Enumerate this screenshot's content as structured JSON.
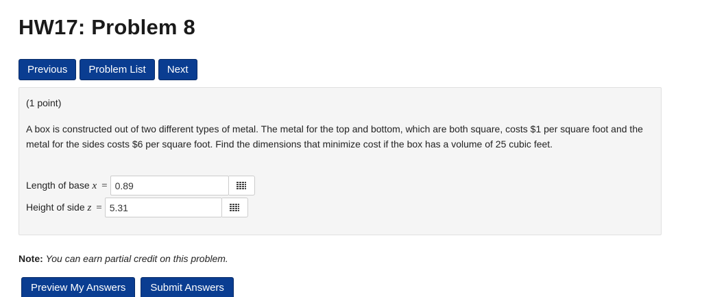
{
  "page": {
    "title": "HW17: Problem 8"
  },
  "nav": {
    "previous_label": "Previous",
    "problem_list_label": "Problem List",
    "next_label": "Next"
  },
  "problem": {
    "points": "(1 point)",
    "text": "A box is constructed out of two different types of metal. The metal for the top and bottom, which are both square, costs $1 per square foot and the metal for the sides costs $6 per square foot. Find the dimensions that minimize cost if the box has a volume of 25 cubic feet.",
    "answers": [
      {
        "label": "Length of base",
        "variable": "x",
        "equals": "=",
        "value": "0.89",
        "keypad_icon": "grid-keypad-icon"
      },
      {
        "label": "Height of side",
        "variable": "z",
        "equals": "=",
        "value": "5.31",
        "keypad_icon": "grid-keypad-icon"
      }
    ]
  },
  "note": {
    "label": "Note:",
    "text": "You can earn partial credit on this problem."
  },
  "actions": {
    "preview_label": "Preview My Answers",
    "submit_label": "Submit Answers"
  },
  "colors": {
    "button_bg": "#0a3d91",
    "panel_bg": "#f5f5f5"
  }
}
